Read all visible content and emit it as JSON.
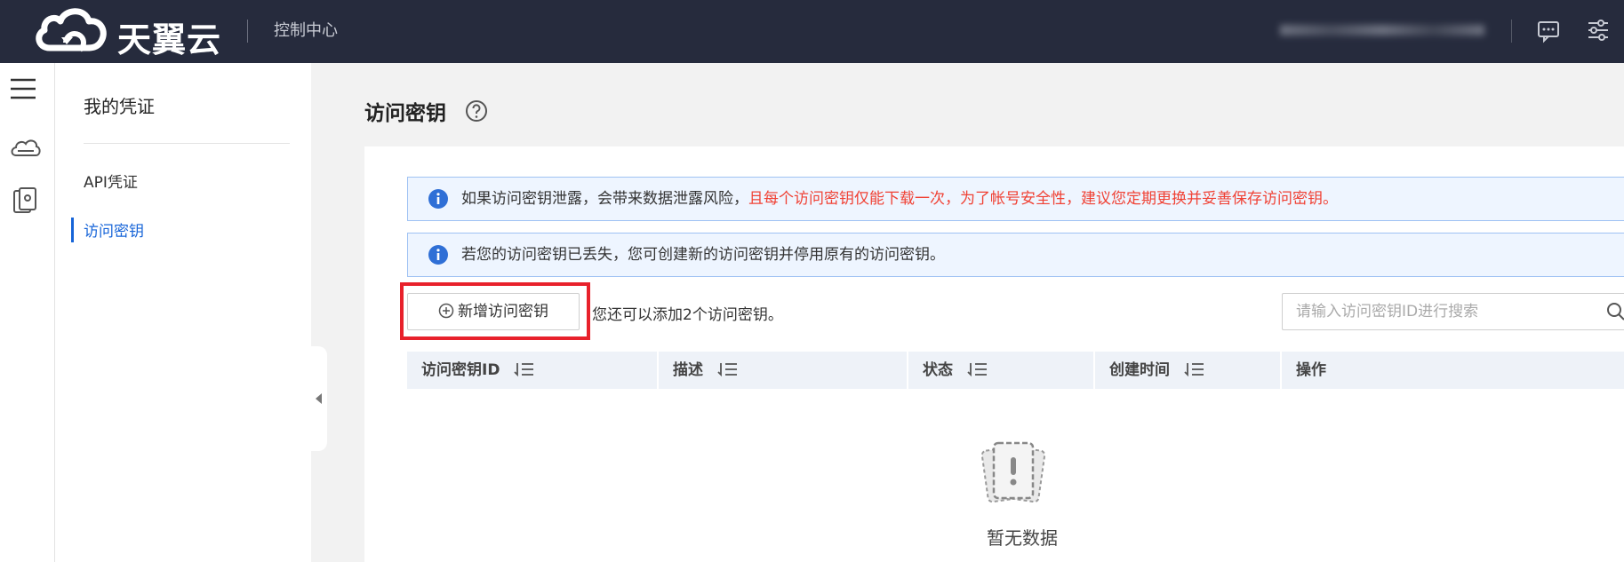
{
  "header": {
    "brand": "天翼云",
    "console": "控制中心"
  },
  "sidebar": {
    "title": "我的凭证",
    "items": [
      {
        "label": "API凭证",
        "active": false
      },
      {
        "label": "访问密钥",
        "active": true
      }
    ]
  },
  "main": {
    "title": "访问密钥",
    "alerts": [
      {
        "text": "如果访问密钥泄露，会带来数据泄露风险，",
        "warning": "且每个访问密钥仅能下载一次，为了帐号安全性，建议您定期更换并妥善保存访问密钥。"
      },
      {
        "text": "若您的访问密钥已丢失，您可创建新的访问密钥并停用原有的访问密钥。",
        "warning": ""
      }
    ],
    "add_button": "新增访问密钥",
    "remaining": "您还可以添加2个访问密钥。",
    "search_placeholder": "请输入访问密钥ID进行搜索",
    "columns": [
      "访问密钥ID",
      "描述",
      "状态",
      "创建时间",
      "操作"
    ],
    "empty_text": "暂无数据"
  },
  "colors": {
    "topbar": "#262b3d",
    "accent": "#1664d8",
    "warning": "#f04134",
    "highlight": "#e8212b"
  }
}
